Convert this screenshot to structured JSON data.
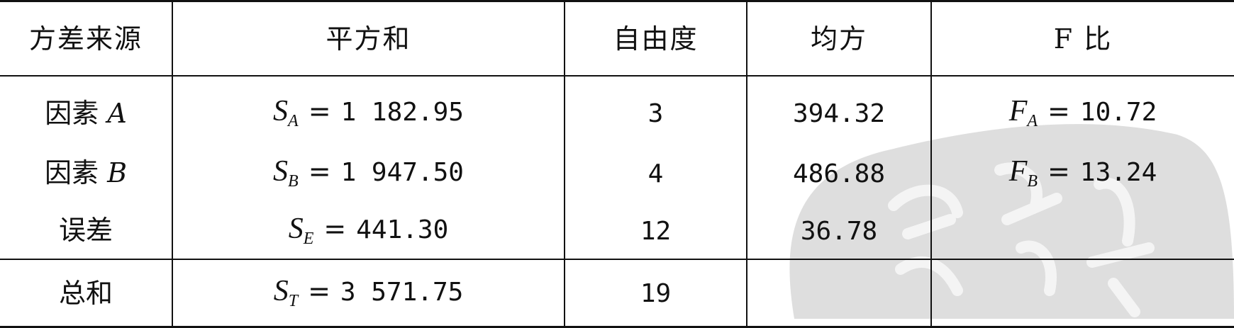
{
  "table": {
    "headers": [
      "方差来源",
      "平方和",
      "自由度",
      "均方",
      "F 比"
    ],
    "rows": [
      {
        "source_prefix": "因素 ",
        "source_var": "A",
        "ss_var": "S",
        "ss_sub": "A",
        "ss_eq": "=",
        "ss_value": "1 182.95",
        "df": "3",
        "ms": "394.32",
        "f_var": "F",
        "f_sub": "A",
        "f_eq": "=",
        "f_value": "10.72"
      },
      {
        "source_prefix": "因素 ",
        "source_var": "B",
        "ss_var": "S",
        "ss_sub": "B",
        "ss_eq": "=",
        "ss_value": "1 947.50",
        "df": "4",
        "ms": "486.88",
        "f_var": "F",
        "f_sub": "B",
        "f_eq": "=",
        "f_value": "13.24"
      },
      {
        "source_prefix": "误差",
        "source_var": "",
        "ss_var": "S",
        "ss_sub": "E",
        "ss_eq": "=",
        "ss_value": "441.30",
        "df": "12",
        "ms": "36.78",
        "f_var": "",
        "f_sub": "",
        "f_eq": "",
        "f_value": ""
      }
    ],
    "total": {
      "source": "总和",
      "ss_var": "S",
      "ss_sub": "T",
      "ss_eq": "=",
      "ss_value": "3 571.75",
      "df": "19",
      "ms": "",
      "f": ""
    }
  },
  "colors": {
    "watermark": "#d9d9d9",
    "rule": "#111111"
  }
}
